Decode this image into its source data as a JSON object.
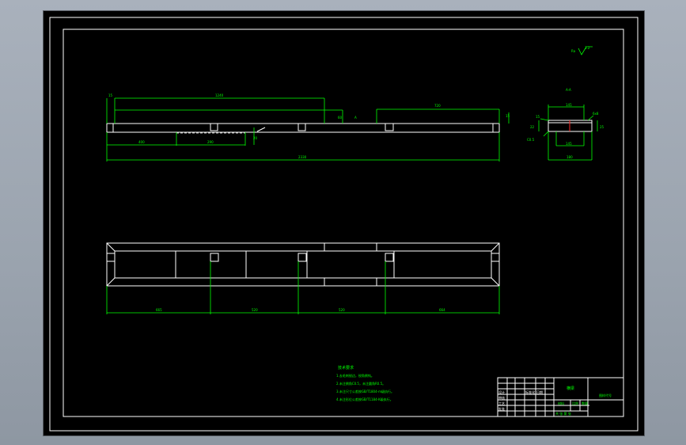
{
  "drawing": {
    "roughness_symbol": "3.2",
    "section_label": "A-A",
    "front_dims": {
      "overall_length": "2330",
      "top_left_length": "1240",
      "top_right_length": "720",
      "left_offset": "15",
      "left_dim": "400",
      "mid_dim": "290",
      "height_dim": "20",
      "side_dim": "60",
      "right_height": "15",
      "small_mark": "A"
    },
    "section_dims": {
      "top_width": "145",
      "bottom_width": "145",
      "overall_width": "180",
      "right_label": "6x8",
      "height": "25",
      "left_height": "22",
      "callout_left": "C0.5",
      "callout_bottom": "R0.5",
      "left_small": "15"
    },
    "plan_dims": {
      "seg1": "665",
      "seg2": "520",
      "seg3": "520",
      "seg4": "664",
      "cutout_label": "70"
    },
    "notes": {
      "title": "技术要求",
      "items": [
        "1.去毛刺锐边，锐角倒钝。",
        "2.未注倒角C0.5，未注圆角R0.5。",
        "3.未注尺寸公差按GB/T1804-m级执行。",
        "4.未注形位公差按GB/T1184-K级执行。"
      ]
    },
    "title_block": {
      "part_name": "横梁",
      "drawing_no": "图样代号",
      "material_label": "材料",
      "scale_label": "比例",
      "qty_label": "数量",
      "sheet_label": "共 张 第 张",
      "cells": [
        "设计",
        "审核",
        "工艺",
        "批准",
        "标准化",
        "日期"
      ]
    }
  }
}
